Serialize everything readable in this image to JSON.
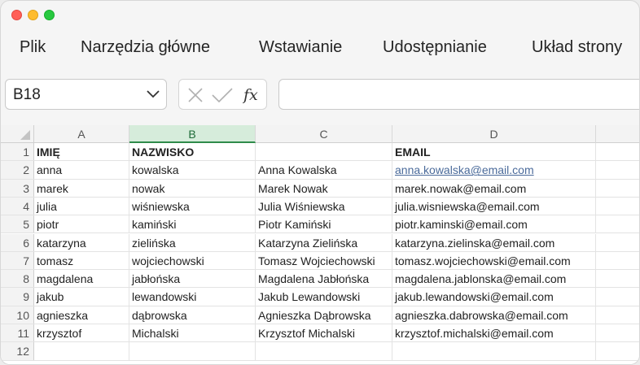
{
  "menu": [
    "Plik",
    "Narzędzia główne",
    "Wstawianie",
    "Udostępnianie",
    "Układ strony"
  ],
  "formula_bar": {
    "name_box": "B18",
    "fx_label": "fx",
    "formula": ""
  },
  "columns": [
    "A",
    "B",
    "C",
    "D"
  ],
  "active_column": "B",
  "rows": [
    {
      "n": "1",
      "a": "IMIĘ",
      "b": "NAZWISKO",
      "c": "",
      "d": "EMAIL"
    },
    {
      "n": "2",
      "a": "anna",
      "b": "kowalska",
      "c": "Anna Kowalska",
      "d": "anna.kowalska@email.com"
    },
    {
      "n": "3",
      "a": "marek",
      "b": "nowak",
      "c": "Marek  Nowak",
      "d": "marek.nowak@email.com"
    },
    {
      "n": "4",
      "a": "julia",
      "b": "wiśniewska",
      "c": "Julia Wiśniewska",
      "d": "julia.wisniewska@email.com"
    },
    {
      "n": "5",
      "a": "piotr",
      "b": "kamiński",
      "c": "Piotr Kamiński",
      "d": "piotr.kaminski@email.com"
    },
    {
      "n": "6",
      "a": "katarzyna",
      "b": "zielińska",
      "c": "Katarzyna Zielińska",
      "d": "katarzyna.zielinska@email.com"
    },
    {
      "n": "7",
      "a": "tomasz",
      "b": "wojciechowski",
      "c": "Tomasz Wojciechowski",
      "d": "tomasz.wojciechowski@email.com"
    },
    {
      "n": "8",
      "a": "magdalena",
      "b": "jabłońska",
      "c": "Magdalena Jabłońska",
      "d": "magdalena.jablonska@email.com"
    },
    {
      "n": "9",
      "a": "jakub",
      "b": "lewandowski",
      "c": "Jakub Lewandowski",
      "d": "jakub.lewandowski@email.com"
    },
    {
      "n": "10",
      "a": "agnieszka",
      "b": "dąbrowska",
      "c": "Agnieszka Dąbrowska",
      "d": "agnieszka.dabrowska@email.com"
    },
    {
      "n": "11",
      "a": "krzysztof",
      "b": "Michalski",
      "c": "Krzysztof Michalski",
      "d": "krzysztof.michalski@email.com"
    },
    {
      "n": "12",
      "a": "",
      "b": "",
      "c": "",
      "d": ""
    }
  ]
}
